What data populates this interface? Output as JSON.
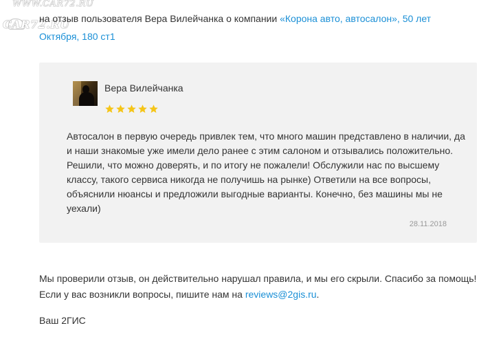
{
  "watermark": {
    "top": "WWW.CAR72.RU",
    "main": "CAR72.RU"
  },
  "intro": {
    "text": "на отзыв пользователя Вера Вилейчанка о компании ",
    "company_link": "«Корона авто, автосалон», 50 лет Октября, 180 ст1"
  },
  "review": {
    "author": "Вера Вилейчанка",
    "rating": 5,
    "max_rating": 5,
    "star_color": "#f5c518",
    "text": "Автосалон в первую очередь привлек тем, что много машин представлено в наличии, да и наши знакомые уже имели дело ранее с этим салоном и отзывались положительно. Решили, что можно доверять, и по итогу не пожалели! Обслужили нас по высшему классу, такого сервиса никогда не получишь на рынке) Ответили на все вопросы, объяснили нюансы и предложили выгодные варианты. Конечно, без машины мы не уехали)",
    "date": "28.11.2018"
  },
  "reply": {
    "text": "Мы проверили отзыв, он действительно нарушал правила, и мы его скрыли. Спасибо за помощь! Если у вас возникли вопросы, пишите нам на ",
    "email": "reviews@2gis.ru",
    "end": "."
  },
  "signature": "Ваш 2ГИС",
  "colors": {
    "link": "#1a8fd6",
    "card_bg": "#f2f2f2",
    "text": "#333333",
    "date": "#999999"
  }
}
